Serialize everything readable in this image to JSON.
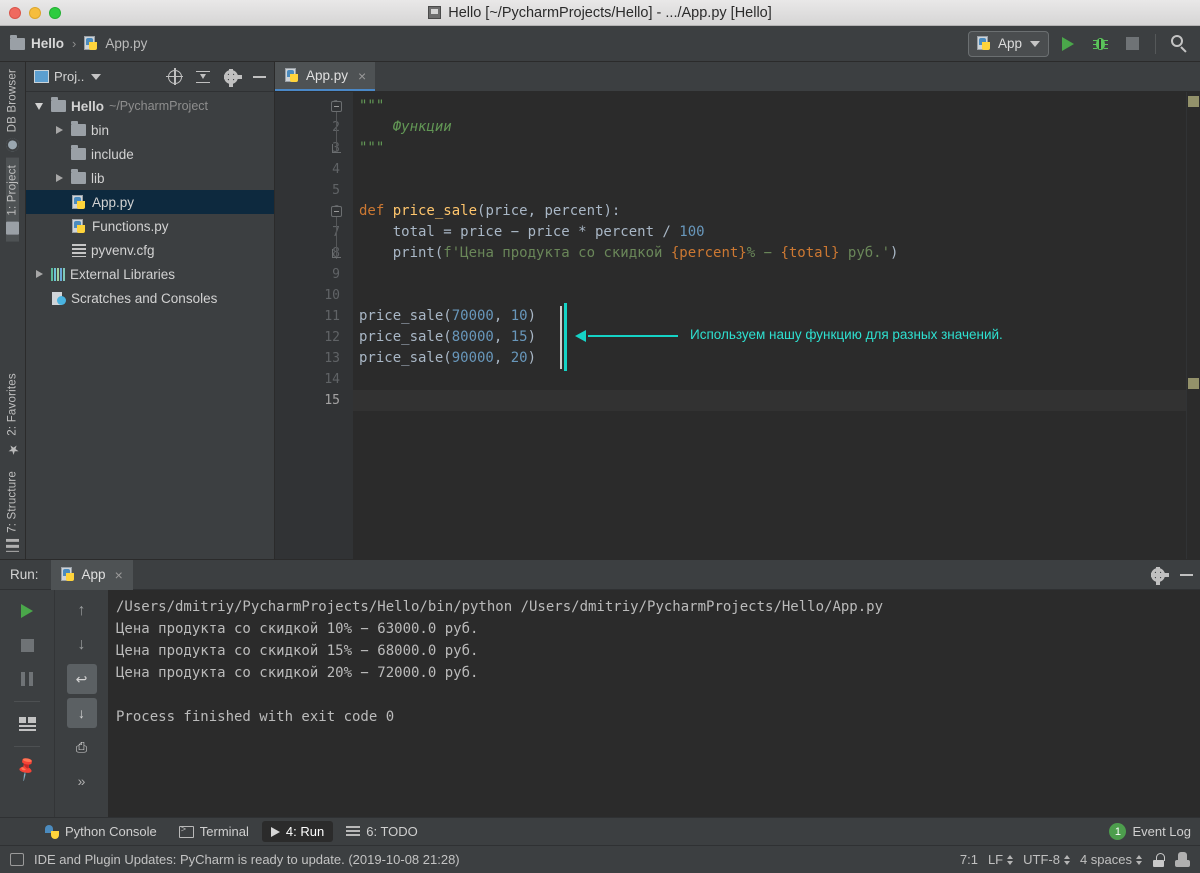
{
  "window": {
    "title": "Hello [~/PycharmProjects/Hello] - .../App.py [Hello]",
    "icon": "project-window-icon"
  },
  "navbar": {
    "breadcrumbs": [
      {
        "label": "Hello",
        "icon": "folder-icon"
      },
      {
        "label": "App.py",
        "icon": "python-file-icon"
      }
    ],
    "separator": "›",
    "run_config": {
      "label": "App",
      "icon": "python-icon",
      "caret": "▾"
    },
    "actions": [
      {
        "name": "run-button",
        "icon": "play-icon"
      },
      {
        "name": "debug-button",
        "icon": "bug-icon"
      },
      {
        "name": "stop-button",
        "icon": "stop-icon"
      },
      {
        "name": "search-everywhere-button",
        "icon": "search-icon"
      }
    ]
  },
  "left_strip": {
    "top_tabs": [
      {
        "label": "DB Browser",
        "icon": "db-browser-icon",
        "active": false
      },
      {
        "label": "1: Project",
        "icon": "folder-icon",
        "active": true
      }
    ],
    "bottom_tabs": [
      {
        "label": "2: Favorites",
        "icon": "star-icon"
      },
      {
        "label": "7: Structure",
        "icon": "structure-icon"
      }
    ]
  },
  "project_panel": {
    "title": "Proj..",
    "caret": "▾",
    "toolbar": [
      {
        "name": "select-opened-file-button",
        "icon": "target-icon"
      },
      {
        "name": "collapse-all-button",
        "icon": "collapse-all-icon"
      },
      {
        "name": "settings-button",
        "icon": "gear-icon"
      },
      {
        "name": "hide-button",
        "icon": "minimize-icon"
      }
    ],
    "tree": [
      {
        "label": "Hello",
        "path": "~/PycharmProject",
        "icon": "folder-icon",
        "twisty": "down",
        "indent": 0,
        "bold": true,
        "selected": false
      },
      {
        "label": "bin",
        "path": "",
        "icon": "folder-icon",
        "twisty": "right",
        "indent": 1,
        "bold": false,
        "selected": false
      },
      {
        "label": "include",
        "path": "",
        "icon": "folder-icon",
        "twisty": "none",
        "indent": 1,
        "bold": false,
        "selected": false
      },
      {
        "label": "lib",
        "path": "",
        "icon": "folder-icon",
        "twisty": "right",
        "indent": 1,
        "bold": false,
        "selected": false
      },
      {
        "label": "App.py",
        "path": "",
        "icon": "python-file-icon",
        "twisty": "none",
        "indent": 2,
        "bold": false,
        "selected": true
      },
      {
        "label": "Functions.py",
        "path": "",
        "icon": "python-file-icon",
        "twisty": "none",
        "indent": 2,
        "bold": false,
        "selected": false
      },
      {
        "label": "pyvenv.cfg",
        "path": "",
        "icon": "config-file-icon",
        "twisty": "none",
        "indent": 2,
        "bold": false,
        "selected": false
      },
      {
        "label": "External Libraries",
        "path": "",
        "icon": "libraries-icon",
        "twisty": "right",
        "indent": 0,
        "bold": false,
        "selected": false
      },
      {
        "label": "Scratches and Consoles",
        "path": "",
        "icon": "scratches-icon",
        "twisty": "none",
        "indent": 0,
        "bold": false,
        "selected": false
      }
    ]
  },
  "editor": {
    "tabs": [
      {
        "label": "App.py",
        "icon": "python-file-icon",
        "close": "×",
        "active": true
      }
    ],
    "line_numbers": [
      "1",
      "2",
      "3",
      "4",
      "5",
      "6",
      "7",
      "8",
      "9",
      "10",
      "11",
      "12",
      "13",
      "14",
      "15"
    ],
    "current_line": 15,
    "lines": [
      {
        "n": 1,
        "tokens": [
          {
            "t": "\"\"\"",
            "c": "docq"
          }
        ]
      },
      {
        "n": 2,
        "tokens": [
          {
            "t": "    Функции",
            "c": "doc"
          }
        ]
      },
      {
        "n": 3,
        "tokens": [
          {
            "t": "\"\"\"",
            "c": "docq"
          }
        ]
      },
      {
        "n": 4,
        "tokens": []
      },
      {
        "n": 5,
        "tokens": []
      },
      {
        "n": 6,
        "tokens": [
          {
            "t": "def ",
            "c": "k"
          },
          {
            "t": "price_sale",
            "c": "fn"
          },
          {
            "t": "(price, percent):",
            "c": "pm"
          }
        ]
      },
      {
        "n": 7,
        "tokens": [
          {
            "t": "    total = price − price * percent / ",
            "c": "pm"
          },
          {
            "t": "100",
            "c": "num"
          }
        ]
      },
      {
        "n": 8,
        "tokens": [
          {
            "t": "    print(",
            "c": "pm"
          },
          {
            "t": "f'Цена продукта со скидкой ",
            "c": "str"
          },
          {
            "t": "{percent}",
            "c": "fb"
          },
          {
            "t": "% − ",
            "c": "str"
          },
          {
            "t": "{total}",
            "c": "fb"
          },
          {
            "t": " руб.'",
            "c": "str"
          },
          {
            "t": ")",
            "c": "pm"
          }
        ]
      },
      {
        "n": 9,
        "tokens": []
      },
      {
        "n": 10,
        "tokens": []
      },
      {
        "n": 11,
        "tokens": [
          {
            "t": "price_sale(",
            "c": "pm"
          },
          {
            "t": "70000",
            "c": "num"
          },
          {
            "t": ", ",
            "c": "pm"
          },
          {
            "t": "10",
            "c": "num"
          },
          {
            "t": ")",
            "c": "pm"
          }
        ]
      },
      {
        "n": 12,
        "tokens": [
          {
            "t": "price_sale(",
            "c": "pm"
          },
          {
            "t": "80000",
            "c": "num"
          },
          {
            "t": ", ",
            "c": "pm"
          },
          {
            "t": "15",
            "c": "num"
          },
          {
            "t": ")",
            "c": "pm"
          }
        ]
      },
      {
        "n": 13,
        "tokens": [
          {
            "t": "price_sale(",
            "c": "pm"
          },
          {
            "t": "90000",
            "c": "num"
          },
          {
            "t": ", ",
            "c": "pm"
          },
          {
            "t": "20",
            "c": "num"
          },
          {
            "t": ")",
            "c": "pm"
          }
        ]
      },
      {
        "n": 14,
        "tokens": []
      },
      {
        "n": 15,
        "tokens": []
      }
    ],
    "annotation": {
      "text": "Используем нашу функцию для разных значений.",
      "color": "#2ee0d0"
    }
  },
  "run_window": {
    "label": "Run:",
    "tab": {
      "label": "App",
      "icon": "python-icon",
      "close": "×"
    },
    "header_actions": [
      {
        "name": "settings-button",
        "icon": "gear-icon"
      },
      {
        "name": "hide-button",
        "icon": "minimize-icon"
      }
    ],
    "side_toolbar": [
      {
        "name": "rerun-button",
        "icon": "play-icon"
      },
      {
        "name": "stop-button",
        "icon": "stop-icon"
      },
      {
        "name": "pause-button",
        "icon": "pause-icon"
      },
      {
        "name": "layout-button",
        "icon": "layout-icon"
      },
      {
        "name": "pin-tab-button",
        "icon": "pin-icon"
      }
    ],
    "side_toolbar2": [
      {
        "name": "up-button",
        "icon": "arrow-up-icon",
        "glyph": "↑"
      },
      {
        "name": "down-button",
        "icon": "arrow-down-icon",
        "glyph": "↓"
      },
      {
        "name": "soft-wrap-button",
        "icon": "soft-wrap-icon",
        "glyph": "↩",
        "active": true
      },
      {
        "name": "scroll-to-end-button",
        "icon": "scroll-to-end-icon",
        "glyph": "↓",
        "active": true
      },
      {
        "name": "print-button",
        "icon": "print-icon",
        "glyph": "⎙"
      },
      {
        "name": "more-button",
        "icon": "chevron-right-icon",
        "glyph": "»"
      }
    ],
    "console_lines": [
      "/Users/dmitriy/PycharmProjects/Hello/bin/python /Users/dmitriy/PycharmProjects/Hello/App.py",
      "Цена продукта со скидкой 10% − 63000.0 руб.",
      "Цена продукта со скидкой 15% − 68000.0 руб.",
      "Цена продукта со скидкой 20% − 72000.0 руб.",
      "",
      "Process finished with exit code 0"
    ]
  },
  "bottom_tabs": [
    {
      "label": "Python Console",
      "icon": "python-console-icon",
      "active": false,
      "mnemonic": ""
    },
    {
      "label": "Terminal",
      "icon": "terminal-icon",
      "active": false,
      "mnemonic": ""
    },
    {
      "label": "4: Run",
      "icon": "run-icon",
      "active": true,
      "mnemonic": "4"
    },
    {
      "label": "6: TODO",
      "icon": "todo-icon",
      "active": false,
      "mnemonic": "6"
    }
  ],
  "event_log": {
    "count": "1",
    "label": "Event Log"
  },
  "statusbar": {
    "message": "IDE and Plugin Updates: PyCharm is ready to update. (2019-10-08 21:28)",
    "caret_position": "7:1",
    "line_separator": "LF",
    "encoding": "UTF-8",
    "indent": "4 spaces",
    "lock_icon": "unlocked-icon",
    "person_icon": "person-icon"
  }
}
